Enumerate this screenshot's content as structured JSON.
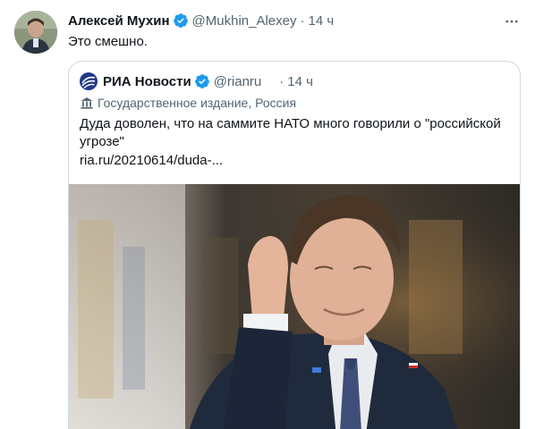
{
  "tweet": {
    "author_name": "Алексей Мухин",
    "author_handle": "@Mukhin_Alexey",
    "dot": "·",
    "time": "14 ч",
    "text": "Это смешно."
  },
  "quoted": {
    "author_name": "РИА Новости",
    "author_handle": "@rianru",
    "dot": "·",
    "time": "14 ч",
    "label": "Государственное издание, Россия",
    "text": "Дуда доволен, что на саммите НАТО много говорили о \"российской угрозе\"",
    "link": "ria.ru/20210614/duda-..."
  },
  "colors": {
    "verified": "#1d9bf0",
    "secondary_text": "#536471",
    "border": "#cfd9de",
    "ria_logo": "#1f3a8a"
  },
  "icons": [
    "verified-badge-icon",
    "more-options-icon",
    "state-media-icon",
    "ria-logo"
  ]
}
